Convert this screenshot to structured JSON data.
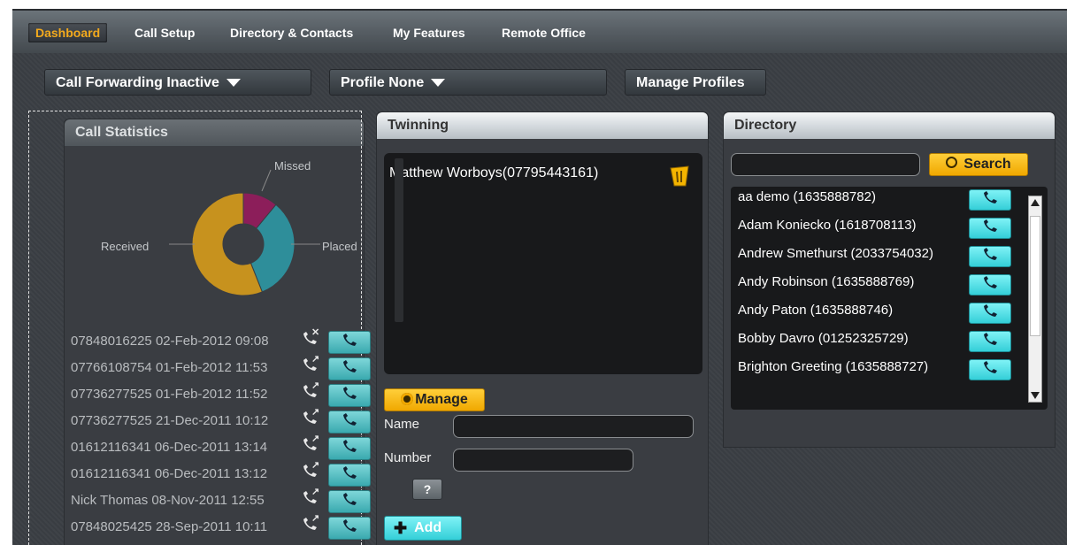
{
  "nav": {
    "tabs": [
      {
        "label": "Dashboard",
        "active": true
      },
      {
        "label": "Call Setup"
      },
      {
        "label": "Directory & Contacts"
      },
      {
        "label": "My Features"
      },
      {
        "label": "Remote Office"
      }
    ]
  },
  "subbar": {
    "call_forwarding": "Call Forwarding Inactive",
    "profile": "Profile None",
    "manage_profiles": "Manage Profiles"
  },
  "call_statistics": {
    "title": "Call Statistics",
    "chart_data": {
      "type": "pie",
      "labels": [
        "Missed",
        "Placed",
        "Received"
      ],
      "values": [
        11,
        33,
        56
      ],
      "colors": [
        "#8c1e5a",
        "#2e8e9a",
        "#c7921e"
      ]
    },
    "calls": [
      {
        "who": "07848016225",
        "when": "02-Feb-2012 09:08",
        "type": "missed"
      },
      {
        "who": "07766108754",
        "when": "01-Feb-2012 11:53",
        "type": "placed"
      },
      {
        "who": "07736277525",
        "when": "01-Feb-2012 11:52",
        "type": "placed"
      },
      {
        "who": "07736277525",
        "when": "21-Dec-2011 10:12",
        "type": "placed"
      },
      {
        "who": "01612116341",
        "when": "06-Dec-2011 13:14",
        "type": "placed"
      },
      {
        "who": "01612116341",
        "when": "06-Dec-2011 13:12",
        "type": "placed"
      },
      {
        "who": "Nick Thomas",
        "when": "08-Nov-2011 12:55",
        "type": "placed"
      },
      {
        "who": "07848025425",
        "when": "28-Sep-2011 10:11",
        "type": "placed"
      }
    ]
  },
  "twinning": {
    "title": "Twinning",
    "entry": "Matthew Worboys(07795443161)",
    "manage_label": "Manage",
    "name_label": "Name",
    "number_label": "Number",
    "help_label": "?",
    "add_label": "Add"
  },
  "directory": {
    "title": "Directory",
    "search_label": "Search",
    "search_value": "",
    "contacts": [
      "aa demo (1635888782)",
      "Adam Koniecko (1618708113)",
      "Andrew Smethurst (2033754032)",
      "Andy Robinson (1635888769)",
      "Andy Paton (1635888746)",
      "Bobby Davro (01252325729)",
      "Brighton Greeting (1635888727)"
    ]
  }
}
